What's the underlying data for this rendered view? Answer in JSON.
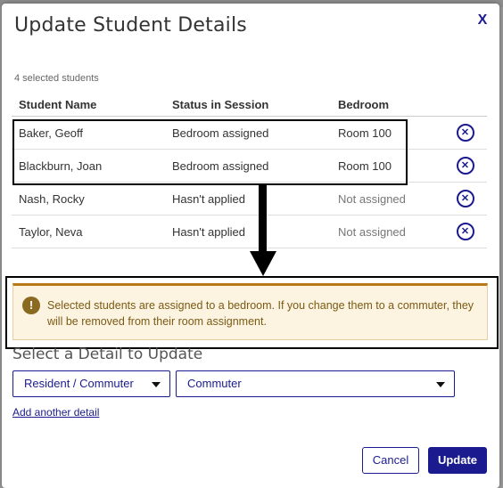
{
  "dialog": {
    "title": "Update Student Details",
    "close_label": "X",
    "selected_count_text": "4 selected students"
  },
  "table": {
    "headers": [
      "Student Name",
      "Status in Session",
      "Bedroom"
    ],
    "rows": [
      {
        "name": "Baker, Geoff",
        "status": "Bedroom assigned",
        "bedroom": "Room 100"
      },
      {
        "name": "Blackburn, Joan",
        "status": "Bedroom assigned",
        "bedroom": "Room 100"
      },
      {
        "name": "Nash, Rocky",
        "status": "Hasn't applied",
        "bedroom": "Not assigned"
      },
      {
        "name": "Taylor, Neva",
        "status": "Hasn't applied",
        "bedroom": "Not assigned"
      }
    ],
    "remove_icon": "remove-circle-icon"
  },
  "alert": {
    "icon": "warning-icon",
    "icon_glyph": "!",
    "text": "Selected students are assigned to a bedroom. If you change them to a commuter, they will be removed from their room assignment."
  },
  "update_section": {
    "label": "Select a Detail to Update",
    "field_select_value": "Resident / Commuter",
    "value_select_value": "Commuter",
    "add_link": "Add another detail"
  },
  "footer": {
    "cancel_label": "Cancel",
    "update_label": "Update"
  },
  "colors": {
    "accent": "#1b1b8f",
    "alert_bg": "#fdf3e1",
    "alert_border": "#b87a17"
  }
}
